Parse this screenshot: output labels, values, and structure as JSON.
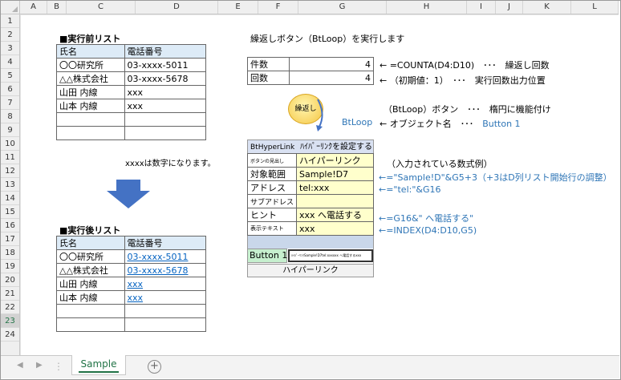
{
  "columns": [
    "A",
    "B",
    "C",
    "D",
    "E",
    "F",
    "G",
    "H",
    "I",
    "J",
    "K",
    "L"
  ],
  "rows": [
    "1",
    "2",
    "3",
    "4",
    "5",
    "6",
    "7",
    "8",
    "9",
    "10",
    "11",
    "12",
    "13",
    "14",
    "15",
    "16",
    "17",
    "18",
    "19",
    "20",
    "21",
    "22",
    "23",
    "24"
  ],
  "before": {
    "title": "■実行前リスト",
    "headers": [
      "氏名",
      "電話番号"
    ],
    "rows": [
      [
        "〇〇研究所",
        "03-xxxx-5011"
      ],
      [
        "△△株式会社",
        "03-xxxx-5678"
      ],
      [
        "山田 内線",
        "xxx"
      ],
      [
        "山本 内線",
        "xxx"
      ],
      [
        "",
        ""
      ],
      [
        "",
        ""
      ]
    ],
    "note": "xxxxは数字になります。"
  },
  "after": {
    "title": "■実行後リスト",
    "headers": [
      "氏名",
      "電話番号"
    ],
    "rows": [
      [
        "〇〇研究所",
        "03-xxxx-5011"
      ],
      [
        "△△株式会社",
        "03-xxxx-5678"
      ],
      [
        "山田 内線",
        "xxx"
      ],
      [
        "山本 内線",
        "xxx"
      ],
      [
        "",
        ""
      ],
      [
        "",
        ""
      ]
    ]
  },
  "header_text": "繰返しボタン（BtLoop）を実行します",
  "count": {
    "label": "件数",
    "value": "4",
    "note": "← =COUNTA(D4:D10)　･･･　繰返し回数"
  },
  "times": {
    "label": "回数",
    "value": "4",
    "note": "← （初期値：1）　･･･　実行回数出力位置"
  },
  "loop_button": {
    "label": "繰返し",
    "caption": "BtLoop",
    "desc1": "（BtLoop）ボタン　･･･　楕円に機能付け",
    "desc2": "← オブジェクト名　･･･　",
    "desc2_val": "Button 1"
  },
  "hyper": {
    "title1": "BtHyperLink",
    "title2": "ﾊｲﾊﾟｰﾘﾝｸを設定する",
    "rows": [
      {
        "label": "ボタンの見出し",
        "value": "ハイパーリンク"
      },
      {
        "label": "対象範囲",
        "value": "Sample!D7"
      },
      {
        "label": "アドレス",
        "value": "tel:xxx"
      },
      {
        "label": "サブアドレス",
        "value": ""
      },
      {
        "label": "ヒント",
        "value": "xxx へ電話する"
      },
      {
        "label": "表示テキスト",
        "value": "xxx"
      }
    ],
    "button": "Button 1",
    "button_small": "ﾊｲﾊﾟｰﾘﾝｸSample!D7tel:xxxxxx へ電話するxxx",
    "footer": "ハイパーリンク",
    "formula_title": "（入力されている数式例）",
    "f1": "←=\"Sample!D\"&G5+3（+3はD列リスト開始行の調整）",
    "f2": "←=\"tel:\"&G16",
    "f3": "←=G16&\" へ電話する\"",
    "f4": "←=INDEX(D4:D10,G5)"
  },
  "sheet_tab": "Sample",
  "colors": {
    "header_blue": "#ddebf7",
    "yellow": "#ffffcc",
    "green": "#c6efce",
    "arrow": "#4472c4",
    "link": "#0563c1"
  }
}
